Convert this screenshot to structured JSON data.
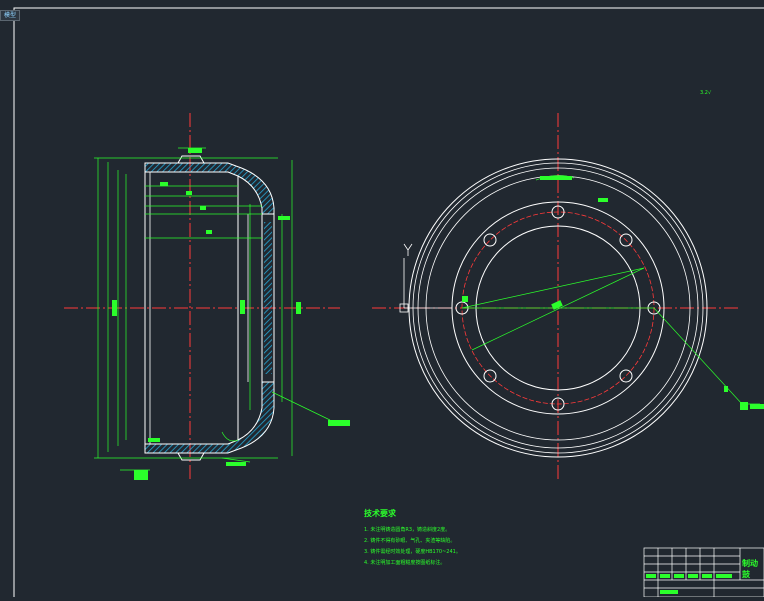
{
  "drawing": {
    "tab_label": "模型",
    "roughness_label": "3.2√",
    "title_block_name": "制动鼓",
    "colors": {
      "background": "#212830",
      "geometry": "#ffffff",
      "dimension": "#2bff2b",
      "centerline": "#ff3a3a",
      "hatch": "#26a7d6"
    }
  },
  "technical_requirements": {
    "title": "技术要求",
    "items": [
      "1. 未注明铸造圆角R3，铸造斜度2度。",
      "2. 铸件不得有砂眼、气孔、夹渣等缺陷。",
      "3. 铸件需经时效处理，硬度HB170~241。",
      "4. 未注明加工面粗糙度按图纸标注。"
    ]
  }
}
